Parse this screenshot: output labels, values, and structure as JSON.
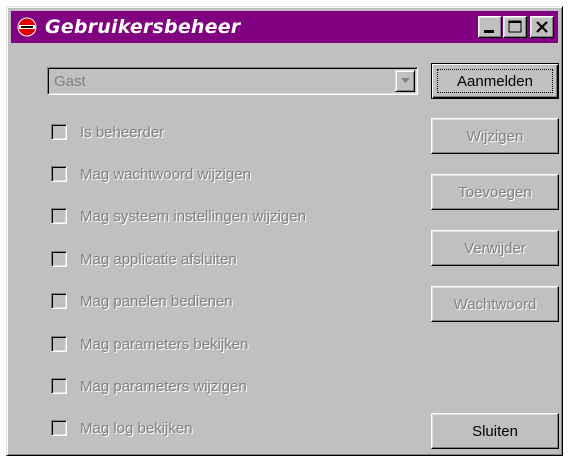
{
  "window": {
    "title": "Gebruikersbeheer",
    "title_bar_color": "#800080",
    "icon": "app-logo-icon"
  },
  "caption_buttons": {
    "minimize_icon": "minimize-icon",
    "maximize_icon": "maximize-icon",
    "close_icon": "close-icon"
  },
  "user_select": {
    "value": "Gast",
    "disabled": true
  },
  "permissions": [
    {
      "label": "Is beheerder",
      "checked": false
    },
    {
      "label": "Mag wachtwoord wijzigen",
      "checked": false
    },
    {
      "label": "Mag systeem instellingen wijzigen",
      "checked": false
    },
    {
      "label": "Mag applicatie afsluiten",
      "checked": false
    },
    {
      "label": "Mag panelen bedienen",
      "checked": false
    },
    {
      "label": "Mag parameters bekijken",
      "checked": false
    },
    {
      "label": "Mag parameters wijzigen",
      "checked": false
    },
    {
      "label": "Mag log bekijken",
      "checked": false
    }
  ],
  "buttons": {
    "login": "Aanmelden",
    "edit": "Wijzigen",
    "add": "Toevoegen",
    "delete": "Verwijder",
    "password": "Wachtwoord",
    "close": "Sluiten"
  }
}
